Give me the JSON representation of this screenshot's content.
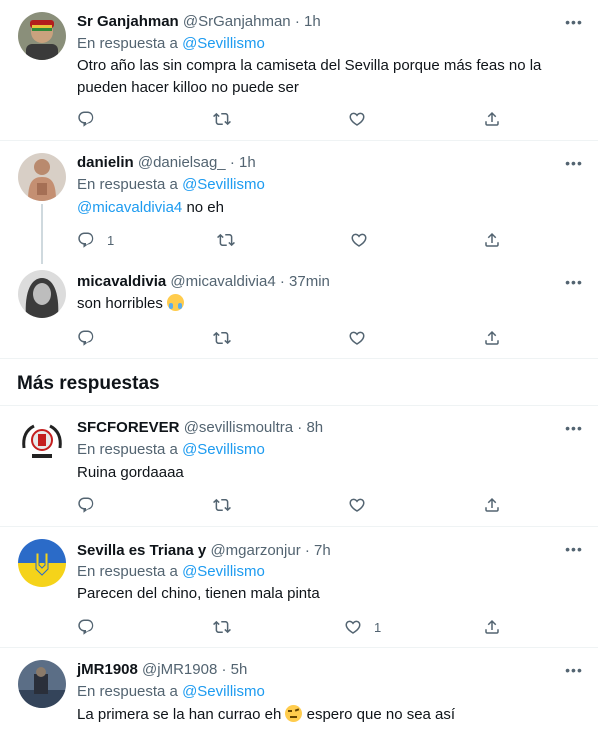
{
  "reply_prefix": "En respuesta a",
  "section_title": "Más respuestas",
  "tweets": [
    {
      "name": "Sr Ganjahman",
      "handle": "@SrGanjahman",
      "dot": "·",
      "time": "1h",
      "reply_to": "@Sevillismo",
      "text": "Otro año las sin compra la camiseta del Sevilla porque más feas no la pueden hacer killoo no puede ser",
      "reply_count": "",
      "like_count": ""
    },
    {
      "name": "danielin",
      "handle": "@danielsag_",
      "dot": "·",
      "time": "1h",
      "reply_to": "@Sevillismo",
      "mention": "@micavaldivia4",
      "text": "no eh",
      "reply_count": "1",
      "like_count": ""
    },
    {
      "name": "micavaldivia",
      "handle": "@micavaldivia4",
      "dot": "·",
      "time": "37min",
      "text": "son horribles",
      "reply_count": "",
      "like_count": ""
    },
    {
      "name": "SFCFOREVER",
      "handle": "@sevillismoultra",
      "dot": "·",
      "time": "8h",
      "reply_to": "@Sevillismo",
      "text": "Ruina gordaaaa",
      "reply_count": "",
      "like_count": ""
    },
    {
      "name": "Sevilla es Triana y",
      "handle": "@mgarzonjur",
      "dot": "·",
      "time": "7h",
      "reply_to": "@Sevillismo",
      "text": "Parecen del chino, tienen mala pinta",
      "reply_count": "",
      "like_count": "1"
    },
    {
      "name": "jMR1908",
      "handle": "@jMR1908",
      "dot": "·",
      "time": "5h",
      "reply_to": "@Sevillismo",
      "text": "La primera se la han currao eh",
      "text_after": "espero que no sea así"
    }
  ],
  "icons": {
    "reply": "reply-icon",
    "retweet": "retweet-icon",
    "like": "like-icon",
    "share": "share-icon",
    "more": "more-icon"
  },
  "colors": {
    "link": "#1d9bf0",
    "secondary": "#536471",
    "divider": "#eff3f4",
    "ukraine_blue": "#2b6bc8",
    "ukraine_yellow": "#f5d31a"
  }
}
